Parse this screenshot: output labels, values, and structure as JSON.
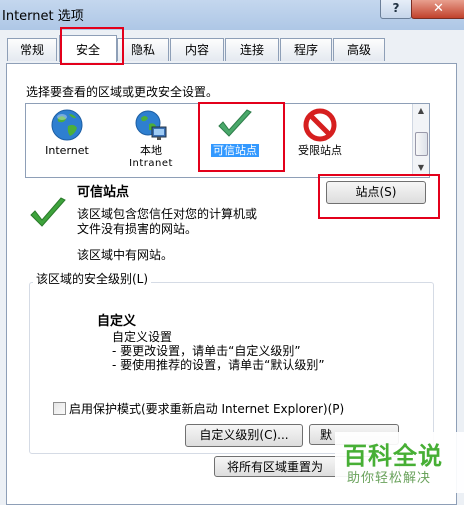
{
  "window": {
    "title": "Internet 选项",
    "help": "?",
    "close": "✕"
  },
  "tabs": [
    "常规",
    "安全",
    "隐私",
    "内容",
    "连接",
    "程序",
    "高级"
  ],
  "security": {
    "zone_prompt": "选择要查看的区域或更改安全设置。",
    "zones": [
      {
        "label": "Internet",
        "label2": "",
        "icon": "globe-icon"
      },
      {
        "label": "本地",
        "label2": "Intranet",
        "icon": "intranet-globe-icon"
      },
      {
        "label": "可信站点",
        "label2": "",
        "icon": "checkmark-icon",
        "selected": true
      },
      {
        "label": "受限站点",
        "label2": "",
        "icon": "no-entry-icon"
      }
    ],
    "selected_zone_title": "可信站点",
    "sites_button": "站点(S)",
    "zone_desc_1": "该区域包含您信任对您的计算机或",
    "zone_desc_2": "文件没有损害的网站。",
    "zone_has_sites": "该区域中有网站。",
    "level_group_label": "该区域的安全级别(L)",
    "level_title": "自定义",
    "level_line_1": "自定义设置",
    "level_line_2": "- 要更改设置，请单击“自定义级别”",
    "level_line_3": "- 要使用推荐的设置，请单击“默认级别”",
    "protected_mode_label": "启用保护模式(要求重新启动 Internet Explorer)(P)",
    "protected_mode_checked": false,
    "custom_level_button": "自定义级别(C)...",
    "default_level_button": "默",
    "reset_all_button": "将所有区域重置为"
  },
  "watermark": {
    "main": "百科全说",
    "sub": "助你轻松解决"
  },
  "colors": {
    "highlight": "#e3001b",
    "selection": "#3399ff",
    "watermark": "#47af35"
  }
}
